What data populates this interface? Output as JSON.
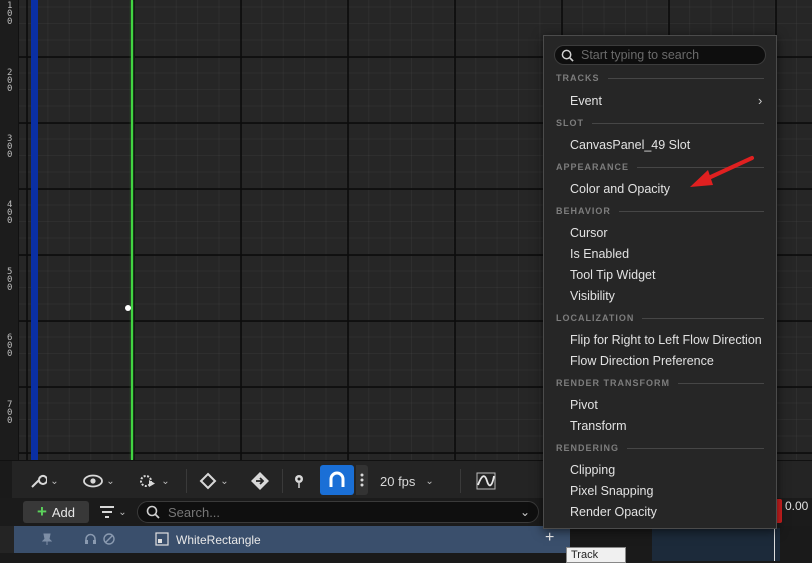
{
  "ruler": {
    "ticks": [
      "1\n0\n0",
      "2\n0\n0",
      "3\n0\n0",
      "4\n0\n0",
      "5\n0\n0",
      "6\n0\n0",
      "7\n0\n0"
    ]
  },
  "toolbar": {
    "fps_label": "20 fps",
    "icons": [
      "wrench-icon",
      "eye-icon",
      "gear-play-icon",
      "diamond-key-icon",
      "key-arrow-icon",
      "pin-icon",
      "magnet-icon",
      "more-icon",
      "curve-editor-icon"
    ]
  },
  "filter_row": {
    "add_label": "Add",
    "search_placeholder": "Search..."
  },
  "track": {
    "name": "WhiteRectangle",
    "add_symbol": "+"
  },
  "timeline": {
    "current_time": "0.00",
    "tooltip_text": "Track"
  },
  "menu": {
    "search_placeholder": "Start typing to search",
    "sections": [
      {
        "title": "TRACKS",
        "items": [
          "Event"
        ]
      },
      {
        "title": "SLOT",
        "items": [
          "CanvasPanel_49 Slot"
        ]
      },
      {
        "title": "APPEARANCE",
        "items": [
          "Color and Opacity"
        ]
      },
      {
        "title": "BEHAVIOR",
        "items": [
          "Cursor",
          "Is Enabled",
          "Tool Tip Widget",
          "Visibility"
        ]
      },
      {
        "title": "LOCALIZATION",
        "items": [
          "Flip for Right to Left Flow Direction",
          "Flow Direction Preference"
        ]
      },
      {
        "title": "RENDER TRANSFORM",
        "items": [
          "Pivot",
          "Transform"
        ]
      },
      {
        "title": "RENDERING",
        "items": [
          "Clipping",
          "Pixel Snapping",
          "Render Opacity"
        ]
      }
    ]
  },
  "colors": {
    "accent_blue": "#1a6fd6",
    "track_row": "#3a4f6c",
    "annotation_arrow": "#e02020",
    "playhead_green": "#42d442"
  }
}
